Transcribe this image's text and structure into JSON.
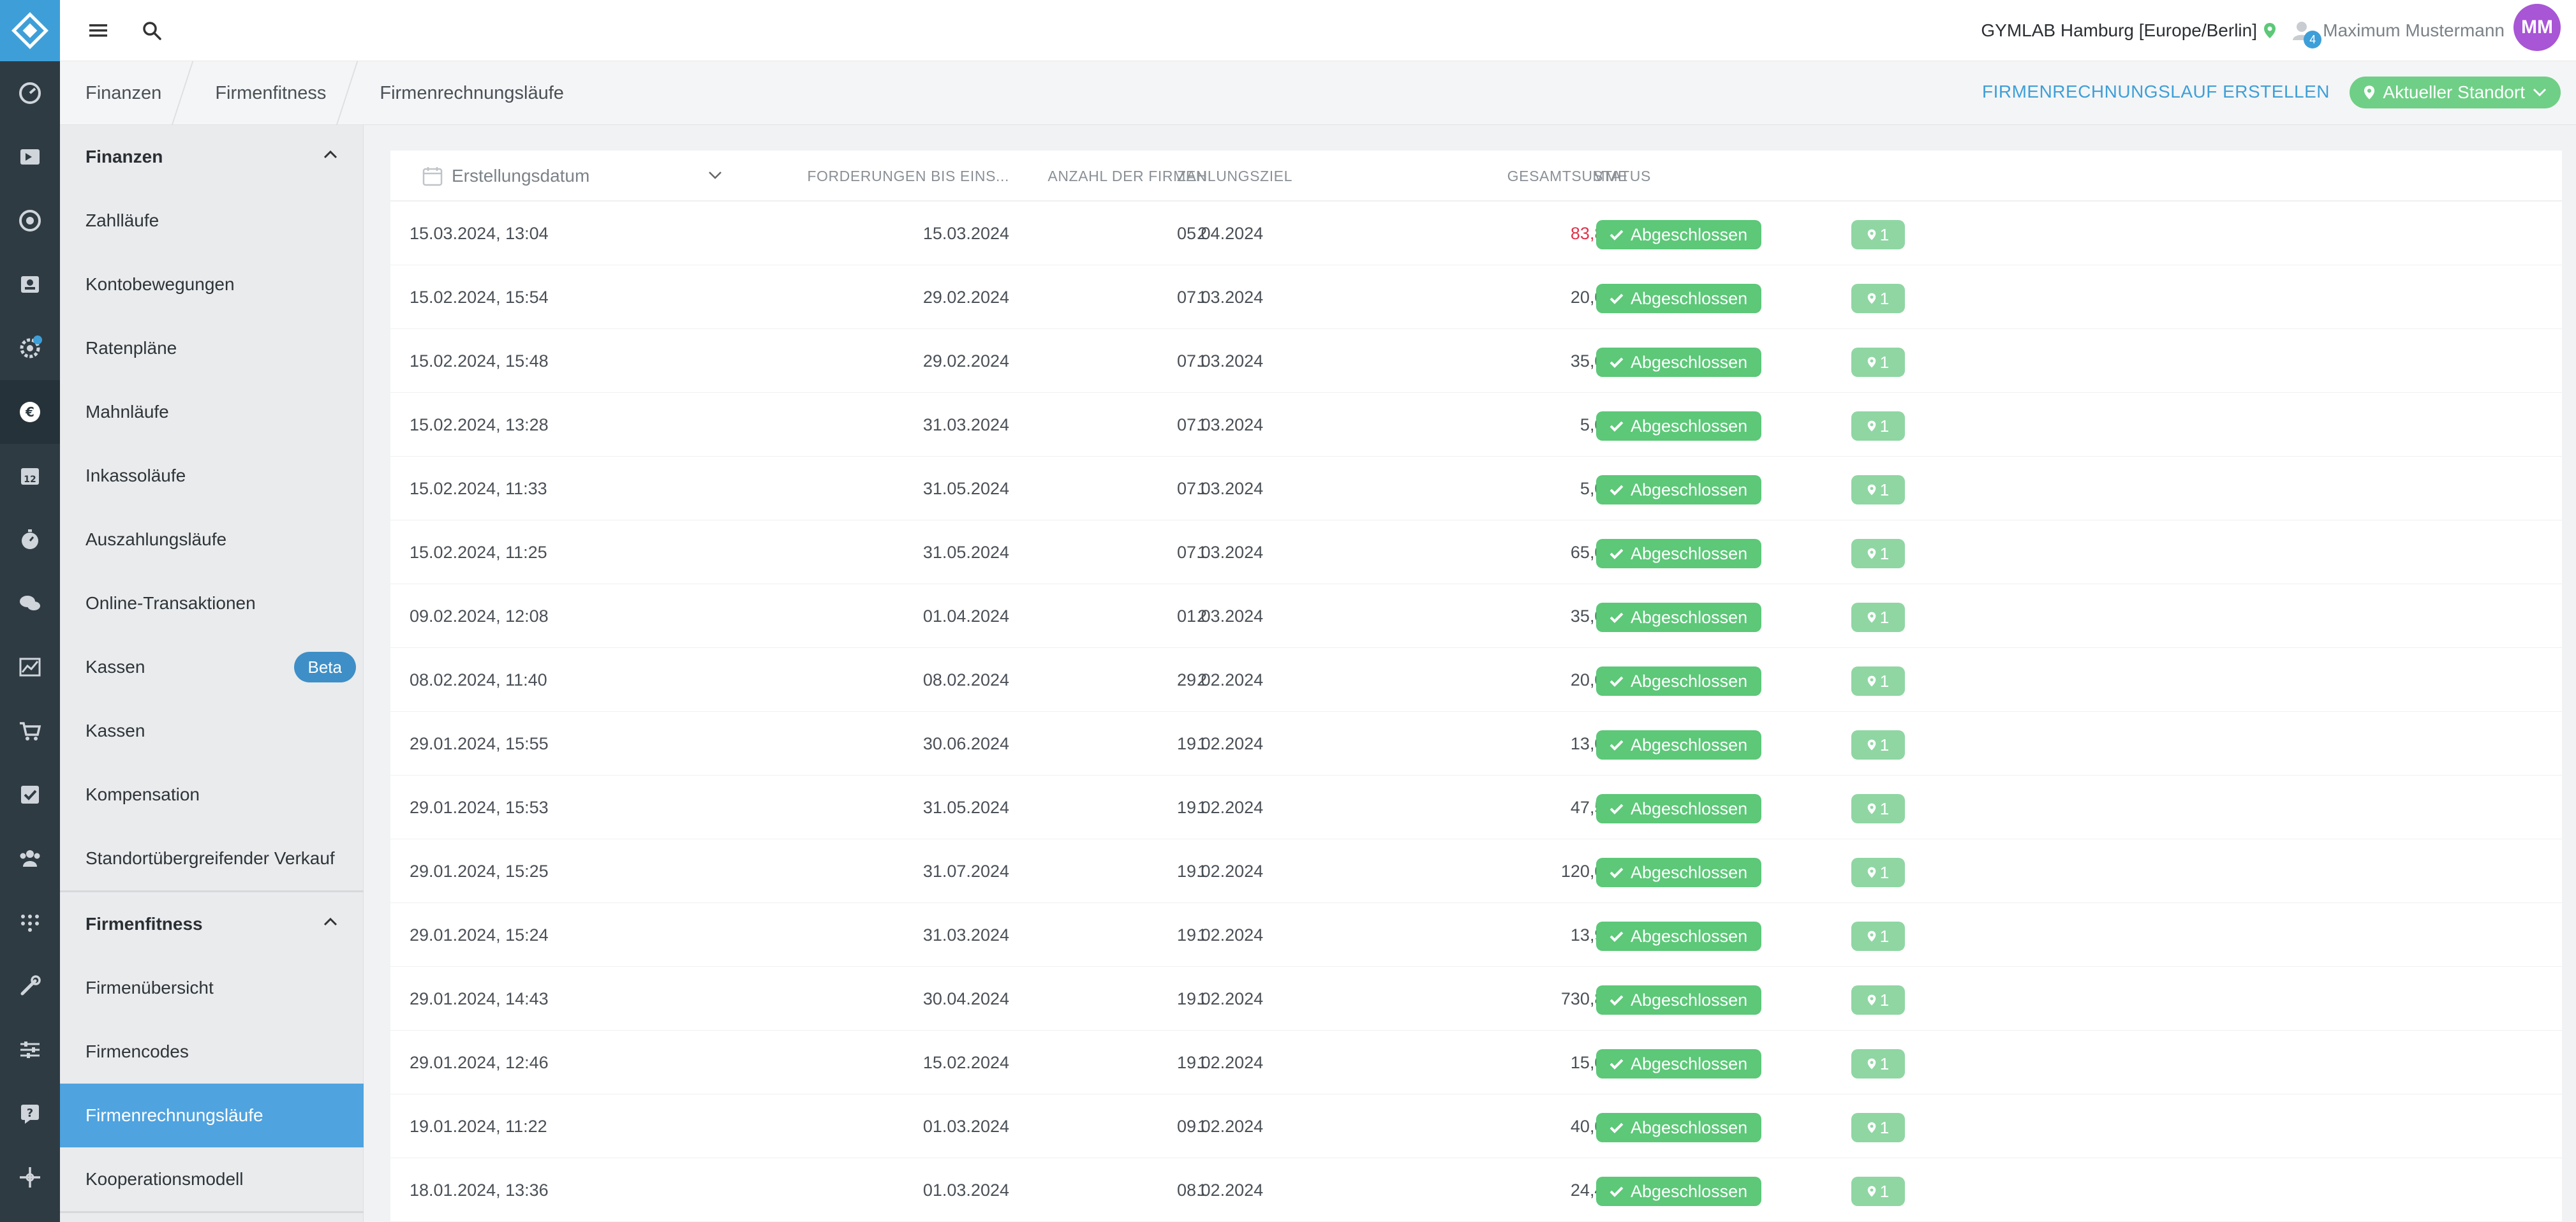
{
  "app": {
    "location": "GYMLAB Hamburg [Europe/Berlin]",
    "user_name": "Maximum Mustermann",
    "user_initials": "MM",
    "notification_count": "4"
  },
  "breadcrumb": [
    "Finanzen",
    "Firmenfitness",
    "Firmenrechnungsläufe"
  ],
  "actions": {
    "create_label": "FIRMENRECHNUNGSLAUF ERSTELLEN",
    "location_filter_label": "Aktueller Standort"
  },
  "sidebar": {
    "finanzen_header": "Finanzen",
    "finanzen_items": [
      {
        "label": "Zahlläufe"
      },
      {
        "label": "Kontobewegungen"
      },
      {
        "label": "Ratenpläne"
      },
      {
        "label": "Mahnläufe"
      },
      {
        "label": "Inkassoläufe"
      },
      {
        "label": "Auszahlungsläufe"
      },
      {
        "label": "Online-Transaktionen"
      },
      {
        "label": "Kassen",
        "badge": "Beta"
      },
      {
        "label": "Kassen"
      },
      {
        "label": "Kompensation"
      },
      {
        "label": "Standortübergreifender Verkauf"
      }
    ],
    "firmenfitness_header": "Firmenfitness",
    "firmenfitness_items": [
      {
        "label": "Firmenübersicht"
      },
      {
        "label": "Firmencodes"
      },
      {
        "label": "Firmenrechnungsläufe",
        "active": true
      },
      {
        "label": "Kooperationsmodell"
      }
    ]
  },
  "table": {
    "columns": {
      "date": "Erstellungsdatum",
      "claims": "FORDERUNGEN BIS EINS...",
      "companies": "ANZAHL DER FIRMEN",
      "due": "ZAHLUNGSZIEL",
      "total": "GESAMTSUMME",
      "status": "STATUS"
    },
    "rows": [
      {
        "created": "15.03.2024, 13:04",
        "claims_until": "15.03.2024",
        "companies": "2",
        "due": "05.04.2024",
        "total": "83,88 €",
        "status": "Abgeschlossen",
        "locations": "1",
        "highlight": true
      },
      {
        "created": "15.02.2024, 15:54",
        "claims_until": "29.02.2024",
        "companies": "1",
        "due": "07.03.2024",
        "total": "20,00 €",
        "status": "Abgeschlossen",
        "locations": "1"
      },
      {
        "created": "15.02.2024, 15:48",
        "claims_until": "29.02.2024",
        "companies": "1",
        "due": "07.03.2024",
        "total": "35,00 €",
        "status": "Abgeschlossen",
        "locations": "1"
      },
      {
        "created": "15.02.2024, 13:28",
        "claims_until": "31.03.2024",
        "companies": "1",
        "due": "07.03.2024",
        "total": "5,00 €",
        "status": "Abgeschlossen",
        "locations": "1"
      },
      {
        "created": "15.02.2024, 11:33",
        "claims_until": "31.05.2024",
        "companies": "1",
        "due": "07.03.2024",
        "total": "5,00 €",
        "status": "Abgeschlossen",
        "locations": "1"
      },
      {
        "created": "15.02.2024, 11:25",
        "claims_until": "31.05.2024",
        "companies": "1",
        "due": "07.03.2024",
        "total": "65,00 €",
        "status": "Abgeschlossen",
        "locations": "1"
      },
      {
        "created": "09.02.2024, 12:08",
        "claims_until": "01.04.2024",
        "companies": "2",
        "due": "01.03.2024",
        "total": "35,00 €",
        "status": "Abgeschlossen",
        "locations": "1"
      },
      {
        "created": "08.02.2024, 11:40",
        "claims_until": "08.02.2024",
        "companies": "2",
        "due": "29.02.2024",
        "total": "20,00 €",
        "status": "Abgeschlossen",
        "locations": "1"
      },
      {
        "created": "29.01.2024, 15:55",
        "claims_until": "30.06.2024",
        "companies": "1",
        "due": "19.02.2024",
        "total": "13,00 €",
        "status": "Abgeschlossen",
        "locations": "1"
      },
      {
        "created": "29.01.2024, 15:53",
        "claims_until": "31.05.2024",
        "companies": "1",
        "due": "19.02.2024",
        "total": "47,52 €",
        "status": "Abgeschlossen",
        "locations": "1"
      },
      {
        "created": "29.01.2024, 15:25",
        "claims_until": "31.07.2024",
        "companies": "1",
        "due": "19.02.2024",
        "total": "120,00 €",
        "status": "Abgeschlossen",
        "locations": "1"
      },
      {
        "created": "29.01.2024, 15:24",
        "claims_until": "31.03.2024",
        "companies": "1",
        "due": "19.02.2024",
        "total": "13,96 €",
        "status": "Abgeschlossen",
        "locations": "1"
      },
      {
        "created": "29.01.2024, 14:43",
        "claims_until": "30.04.2024",
        "companies": "1",
        "due": "19.02.2024",
        "total": "730,82 €",
        "status": "Abgeschlossen",
        "locations": "1"
      },
      {
        "created": "29.01.2024, 12:46",
        "claims_until": "15.02.2024",
        "companies": "1",
        "due": "19.02.2024",
        "total": "15,00 €",
        "status": "Abgeschlossen",
        "locations": "1"
      },
      {
        "created": "19.01.2024, 11:22",
        "claims_until": "01.03.2024",
        "companies": "1",
        "due": "09.02.2024",
        "total": "40,00 €",
        "status": "Abgeschlossen",
        "locations": "1"
      },
      {
        "created": "18.01.2024, 13:36",
        "claims_until": "01.03.2024",
        "companies": "1",
        "due": "08.02.2024",
        "total": "24,40 €",
        "status": "Abgeschlossen",
        "locations": "1"
      }
    ]
  },
  "colors": {
    "accent": "#3e9fd8",
    "success": "#5cc878",
    "negative": "#e0334c",
    "rail": "#2f3b43",
    "avatar": "#a855d6"
  },
  "icons": {
    "rail": [
      "dashboard-icon",
      "checkin-icon",
      "record-icon",
      "members-icon",
      "settings-gear-icon",
      "euro-icon",
      "calendar-icon",
      "timer-icon",
      "chat-icon",
      "chart-icon",
      "cart-icon",
      "tasks-icon",
      "team-icon",
      "network-icon",
      "tools-icon",
      "sliders-icon",
      "help-icon",
      "move-icon"
    ]
  }
}
